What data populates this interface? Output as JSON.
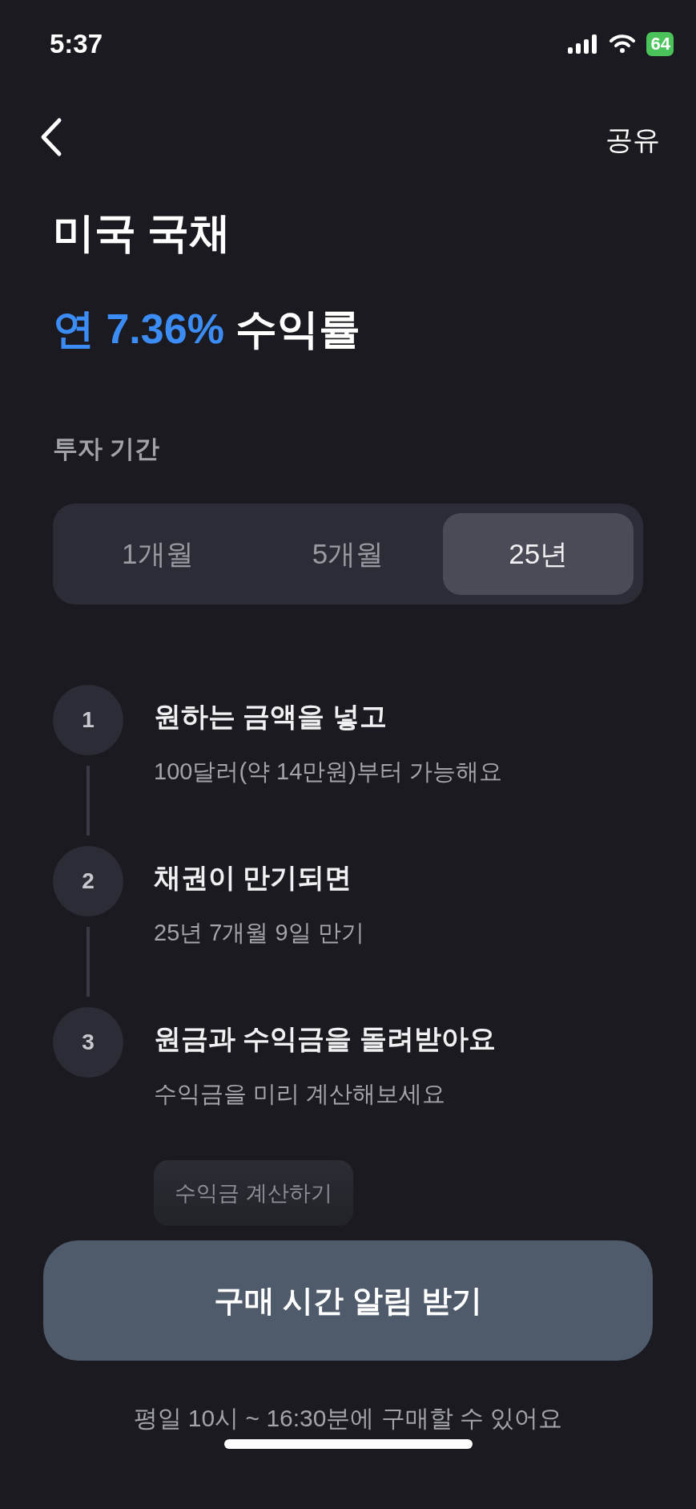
{
  "status_bar": {
    "time": "5:37",
    "battery": "64"
  },
  "nav": {
    "action": "공유"
  },
  "hero": {
    "title": "미국 국채",
    "rate": "연 7.36%",
    "rate_suffix": "수익률"
  },
  "period": {
    "label": "투자 기간",
    "tabs": [
      {
        "label": "1개월",
        "selected": false
      },
      {
        "label": "5개월",
        "selected": false
      },
      {
        "label": "25년",
        "selected": true
      }
    ]
  },
  "steps": [
    {
      "number": "1",
      "title": "원하는 금액을 넣고",
      "subtitle": "100달러(약 14만원)부터 가능해요"
    },
    {
      "number": "2",
      "title": "채권이 만기되면",
      "subtitle": "25년 7개월 9일 만기"
    },
    {
      "number": "3",
      "title": "원금과 수익금을 돌려받아요",
      "subtitle": "수익금을 미리 계산해보세요",
      "action": "수익금 계산하기"
    }
  ],
  "cta": {
    "button": "구매 시간 알림 받기",
    "note": "평일 10시 ~ 16:30분에 구매할 수 있어요"
  }
}
